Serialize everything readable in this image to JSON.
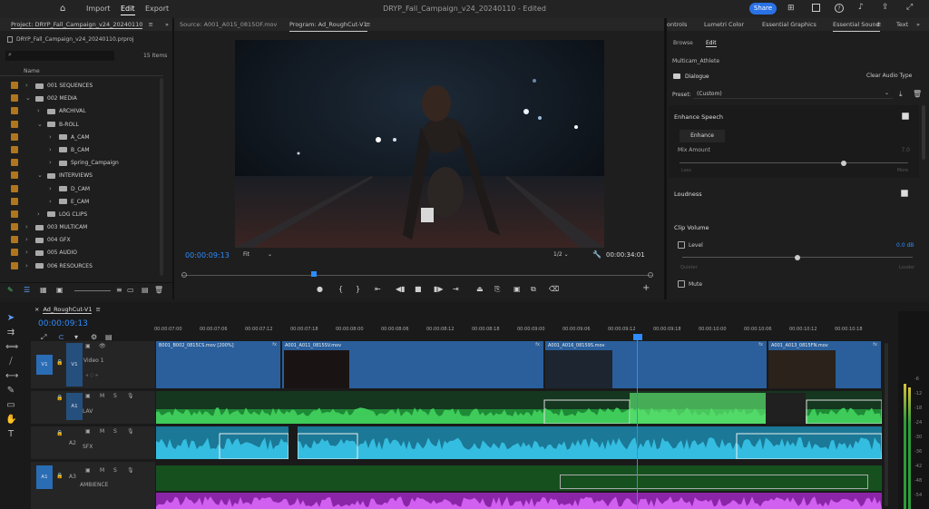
{
  "topbar": {
    "nav": [
      "Import",
      "Edit",
      "Export"
    ],
    "active": "Edit",
    "title": "DRYP_Fall_Campaign_v24_20240110 - Edited",
    "share_label": "Share"
  },
  "project": {
    "tab": "Project: DRYP_Fall_Campaign_v24_20240110",
    "file": "DRYP_Fall_Campaign_v24_20240110.prproj",
    "items_count": "15 Items",
    "name_header": "Name",
    "rows": [
      {
        "label": "001 SEQUENCES",
        "indent": 0,
        "open": false
      },
      {
        "label": "002 MEDIA",
        "indent": 0,
        "open": true
      },
      {
        "label": "ARCHIVAL",
        "indent": 1,
        "open": false
      },
      {
        "label": "B-ROLL",
        "indent": 1,
        "open": true
      },
      {
        "label": "A_CAM",
        "indent": 2,
        "open": false
      },
      {
        "label": "B_CAM",
        "indent": 2,
        "open": false
      },
      {
        "label": "Spring_Campaign",
        "indent": 2,
        "open": false
      },
      {
        "label": "INTERVIEWS",
        "indent": 1,
        "open": true
      },
      {
        "label": "D_CAM",
        "indent": 2,
        "open": false
      },
      {
        "label": "E_CAM",
        "indent": 2,
        "open": false
      },
      {
        "label": "LOG CLIPS",
        "indent": 1,
        "open": false
      },
      {
        "label": "003 MULTICAM",
        "indent": 0,
        "open": false
      },
      {
        "label": "004 GFX",
        "indent": 0,
        "open": false
      },
      {
        "label": "005 AUDIO",
        "indent": 0,
        "open": false
      },
      {
        "label": "006 RESOURCES",
        "indent": 0,
        "open": false
      }
    ]
  },
  "monitor": {
    "source_tab": "Source: A001_A015_0815OF.mov",
    "program_tab": "Program: Ad_RoughCut-V1",
    "timecode_current": "00:00:09:13",
    "fit": "Fit",
    "resolution": "1/2",
    "timecode_duration": "00:00:34:01"
  },
  "panels_tabs": [
    "ontrols",
    "Lumetri Color",
    "Essential Graphics",
    "Essential Sound",
    "Text"
  ],
  "essential_sound": {
    "subtabs": [
      "Browse",
      "Edit"
    ],
    "clip_name": "Multicam_Athlete",
    "type_label": "Dialogue",
    "clear_label": "Clear Audio Type",
    "preset_label": "Preset:",
    "preset_value": "(Custom)",
    "enhance_speech": "Enhance Speech",
    "enhance_btn": "Enhance",
    "mix_amount": "Mix Amount",
    "mix_value": "7.0",
    "mix_min": "Less",
    "mix_max": "More",
    "mix_level": 0.72,
    "loudness": "Loudness",
    "clip_volume": "Clip Volume",
    "level_label": "Level",
    "level_value": "0.0 dB",
    "vol_min": "Quieter",
    "vol_max": "Louder",
    "vol_level": 0.5,
    "mute_label": "Mute"
  },
  "timeline": {
    "seq_tab": "Ad_RoughCut-V1",
    "timecode": "00:00:09:13",
    "ruler": [
      "00:00:07:00",
      "00:00:07:06",
      "00:00:07:12",
      "00:00:07:18",
      "00:00:08:00",
      "00:00:08:06",
      "00:00:08:12",
      "00:00:08:18",
      "00:00:09:00",
      "00:00:09:06",
      "00:00:09:12",
      "00:00:09:18",
      "00:00:10:00",
      "00:00:10:06",
      "00:00:10:12",
      "00:00:10:18"
    ],
    "tracks": {
      "v1": "V1",
      "video1": "Video 1",
      "a1": "A1",
      "a2": "A2",
      "a3": "A3",
      "lav": "LAV",
      "sfx": "SFX",
      "ambience": "AMBIENCE"
    },
    "clips": {
      "c1": "B001_B002_0815CS.mov [200%]",
      "c2": "A001_A011_0815SV.mov",
      "c3": "A001_A016_08159S.mov",
      "c4": "A001_A013_0815FN.mov"
    }
  },
  "meter": {
    "labels": [
      "-6",
      "-12",
      "-18",
      "-24",
      "-30",
      "-36",
      "-42",
      "-48",
      "-54"
    ]
  },
  "colors": {
    "accent": "#2d8cff",
    "video_clip": "#2a5f9c",
    "audio_lav": "#1d8a33",
    "audio_sfx": "#1d8fb0",
    "audio_amb": "#9c2fb8"
  }
}
